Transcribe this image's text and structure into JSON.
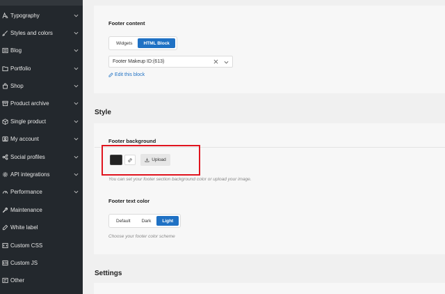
{
  "sidebar": {
    "items": [
      {
        "label": "Typography",
        "icon": "typography-icon",
        "has_chevron": true
      },
      {
        "label": "Styles and colors",
        "icon": "brush-icon",
        "has_chevron": true
      },
      {
        "label": "Blog",
        "icon": "blog-icon",
        "has_chevron": true
      },
      {
        "label": "Portfolio",
        "icon": "portfolio-icon",
        "has_chevron": true
      },
      {
        "label": "Shop",
        "icon": "shop-icon",
        "has_chevron": true
      },
      {
        "label": "Product archive",
        "icon": "archive-icon",
        "has_chevron": true
      },
      {
        "label": "Single product",
        "icon": "product-icon",
        "has_chevron": true
      },
      {
        "label": "My account",
        "icon": "account-icon",
        "has_chevron": true
      },
      {
        "label": "Social profiles",
        "icon": "social-icon",
        "has_chevron": true
      },
      {
        "label": "API integrations",
        "icon": "gear-icon",
        "has_chevron": true
      },
      {
        "label": "Performance",
        "icon": "performance-icon",
        "has_chevron": true
      },
      {
        "label": "Maintenance",
        "icon": "wrench-icon",
        "has_chevron": false
      },
      {
        "label": "White label",
        "icon": "pen-icon",
        "has_chevron": false
      },
      {
        "label": "Custom CSS",
        "icon": "css-icon",
        "has_chevron": false
      },
      {
        "label": "Custom JS",
        "icon": "js-icon",
        "has_chevron": false
      },
      {
        "label": "Other",
        "icon": "other-icon",
        "has_chevron": false
      }
    ]
  },
  "footer_content": {
    "label": "Footer content",
    "options": [
      "Widgets",
      "HTML Block"
    ],
    "selected": "HTML Block",
    "select_value": "Footer Makeup ID:(613)",
    "edit_link": "Edit this block"
  },
  "style": {
    "title": "Style",
    "footer_background": {
      "label": "Footer background",
      "color": "#222222",
      "upload_label": "Upload",
      "hint": "You can set your footer section background color or upload your image."
    },
    "footer_text_color": {
      "label": "Footer text color",
      "options": [
        "Default",
        "Dark",
        "Light"
      ],
      "selected": "Light",
      "hint": "Choose your footer color scheme"
    }
  },
  "settings": {
    "title": "Settings"
  },
  "colors": {
    "accent": "#1f71c4",
    "sidebar_bg": "#23282d",
    "highlight": "#e0141e"
  }
}
